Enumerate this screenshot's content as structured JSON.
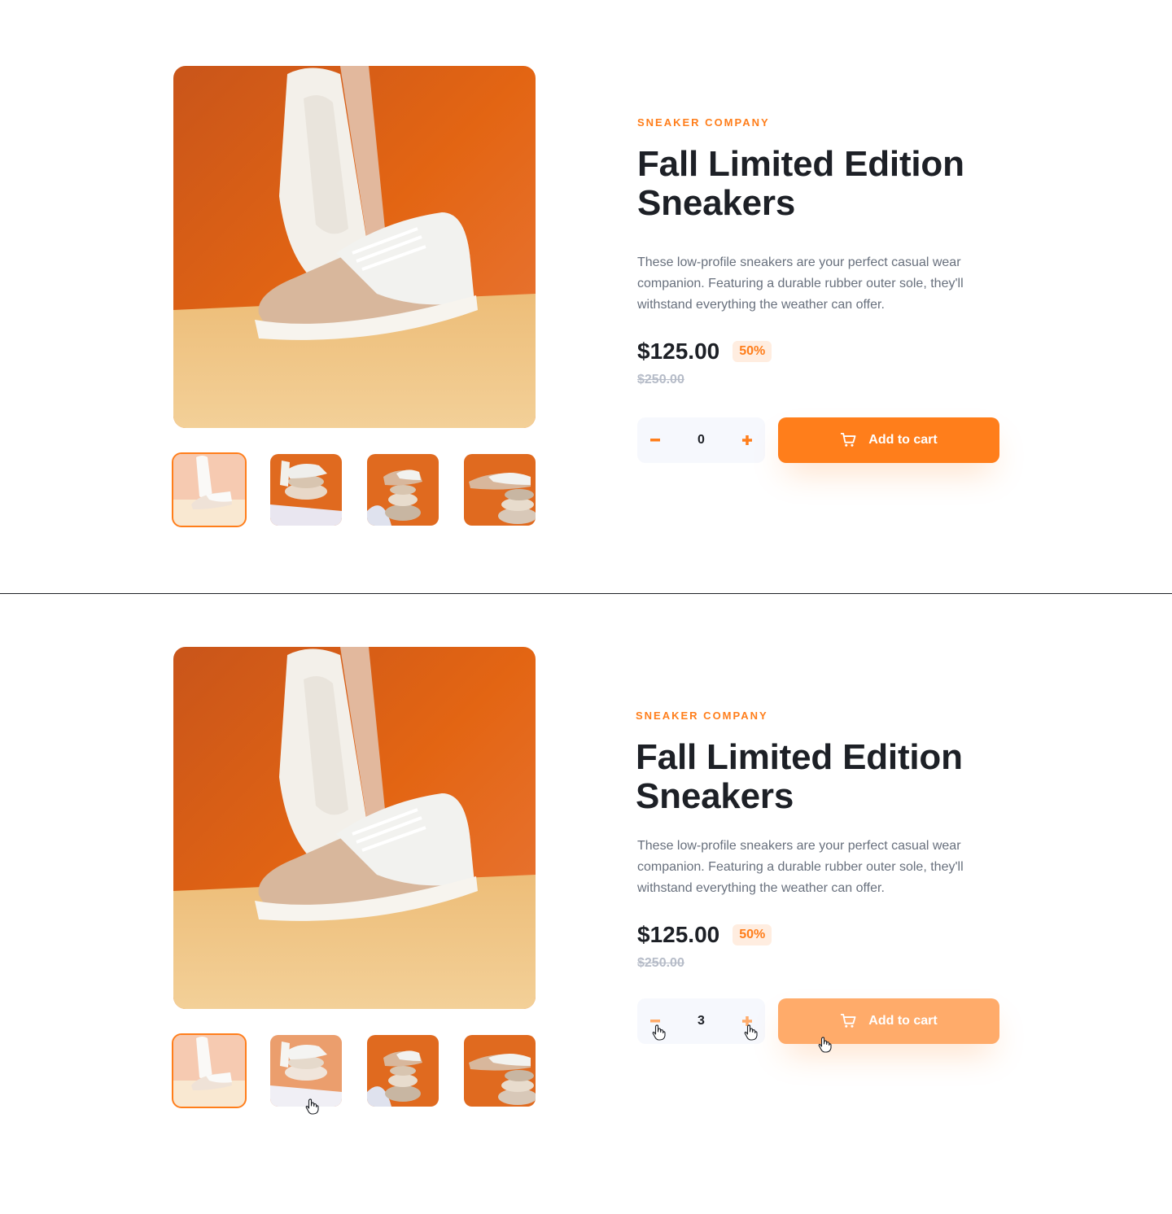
{
  "product": {
    "company": "SNEAKER COMPANY",
    "title_line1": "Fall Limited Edition",
    "title_line2": "Sneakers",
    "description": "These low-profile sneakers are your perfect casual wear companion. Featuring a durable rubber outer sole, they'll withstand everything the weather can offer.",
    "price": "$125.00",
    "discount": "50%",
    "original_price": "$250.00",
    "cart_label": "Add to cart"
  },
  "states": {
    "default": {
      "quantity": "0",
      "active_thumbnail": 1
    },
    "interacting": {
      "quantity": "3",
      "active_thumbnail": 1,
      "hovered_thumbnail": 2,
      "cart_button": "hover"
    }
  },
  "colors": {
    "accent": "#ff7e1b",
    "accent_hover": "#ffab6a",
    "accent_pale": "#ffede0",
    "text_dark": "#1d2026",
    "text_gray": "#68707d",
    "text_light": "#b6bcc8",
    "stepper_bg": "#f6f8fd"
  },
  "icons": {
    "minus": "minus-icon",
    "plus": "plus-icon",
    "cart": "cart-icon",
    "cursor": "hand-pointer-icon"
  }
}
